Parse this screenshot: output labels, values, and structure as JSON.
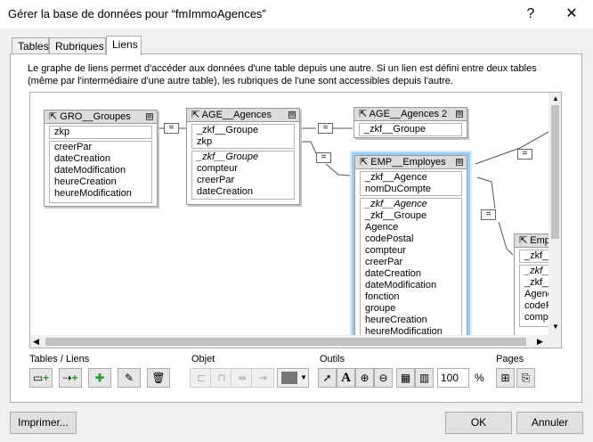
{
  "window": {
    "title": "Gérer la base de données pour “fmImmoAgences”",
    "help": "?",
    "close": "✕"
  },
  "tabs": [
    {
      "label": "Tables"
    },
    {
      "label": "Rubriques"
    },
    {
      "label": "Liens"
    }
  ],
  "description": "Le graphe de liens permet d'accéder aux données d'une table depuis une autre. Si un lien est défini entre deux tables (même par l'intermédiaire d'une autre table), les rubriques de l'une sont accessibles depuis l'autre.",
  "graph": {
    "tables": [
      {
        "name": "GRO__Groupes",
        "keys": [
          "zkp"
        ],
        "fields": [
          "creerPar",
          "dateCreation",
          "dateModification",
          "heureCreation",
          "heureModification"
        ]
      },
      {
        "name": "AGE__Agences",
        "keys": [
          "_zkf__Groupe",
          "zkp"
        ],
        "fields": [
          "_zkf__Groupe",
          "compteur",
          "creerPar",
          "dateCreation"
        ]
      },
      {
        "name": "AGE__Agences 2",
        "keys": [
          "_zkf__Groupe"
        ],
        "fields": []
      },
      {
        "name": "EMP__Employes",
        "keys": [
          "_zkf__Agence",
          "nomDuCompte"
        ],
        "fields": [
          "_zkf__Agence",
          "_zkf__Groupe",
          "Agence",
          "codePostal",
          "compteur",
          "creerPar",
          "dateCreation",
          "dateModification",
          "fonction",
          "groupe",
          "heureCreation",
          "heureModification"
        ]
      },
      {
        "name": "Employ",
        "keys": [
          "_zkf__"
        ],
        "fields": [
          "_zkf__",
          "_zkf__",
          "Agenc",
          "codeP",
          "compt"
        ]
      }
    ],
    "link_symbol": "="
  },
  "sections": {
    "tables_links": "Tables / Liens",
    "object": "Objet",
    "tools": "Outils",
    "pages": "Pages"
  },
  "zoom": {
    "value": "100",
    "unit": "%"
  },
  "buttons": {
    "print": "Imprimer...",
    "ok": "OK",
    "cancel": "Annuler"
  }
}
